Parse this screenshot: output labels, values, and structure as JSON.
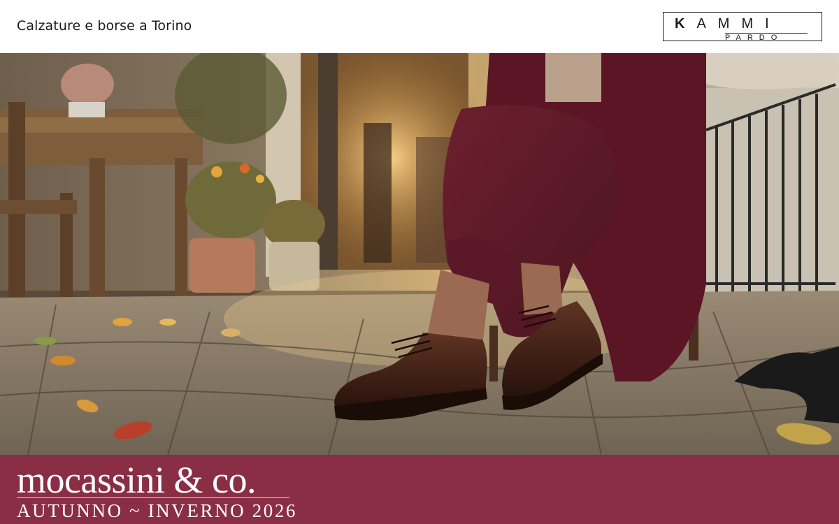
{
  "header": {
    "tagline": "Calzature e borse a Torino",
    "logo": {
      "brand_first": "K",
      "brand_rest": "AMMI",
      "sub": "PARDO"
    }
  },
  "hero": {
    "subject": "brown leather brogue lace-up shoes"
  },
  "banner": {
    "title": "mocassini & co.",
    "season": "AUTUNNO ~ INVERNO 2026",
    "background_color": "#8a2e45"
  }
}
